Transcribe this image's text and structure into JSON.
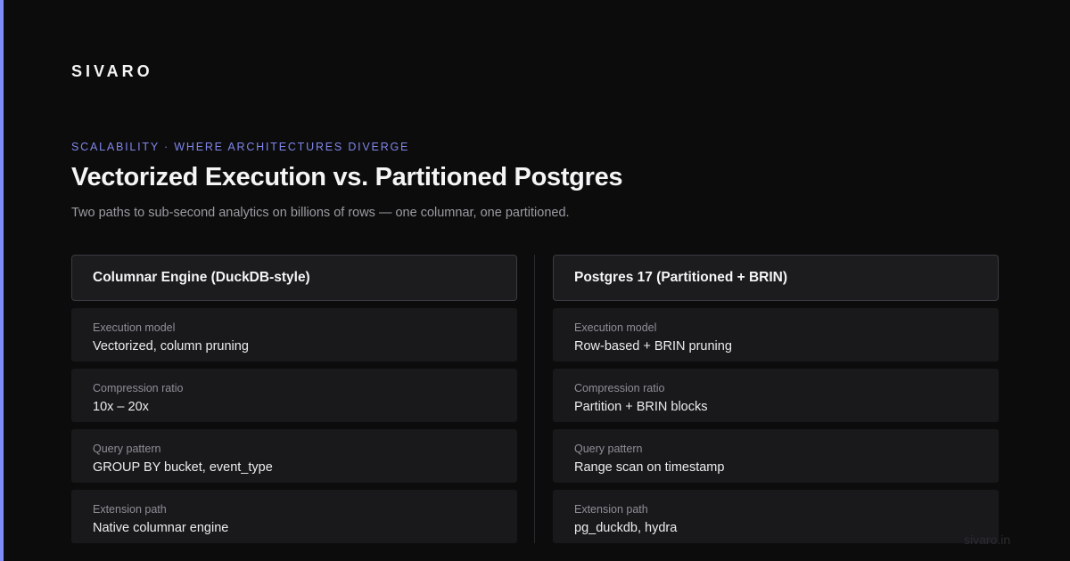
{
  "brand": "SIVARO",
  "eyebrow": "SCALABILITY · WHERE ARCHITECTURES DIVERGE",
  "title": "Vectorized Execution vs. Partitioned Postgres",
  "subtitle": "Two paths to sub-second analytics on billions of rows — one columnar, one partitioned.",
  "columns": [
    {
      "header": "Columnar Engine (DuckDB-style)",
      "rows": [
        {
          "label": "Execution model",
          "value": "Vectorized, column pruning"
        },
        {
          "label": "Compression ratio",
          "value": "10x – 20x"
        },
        {
          "label": "Query pattern",
          "value": "GROUP BY bucket, event_type"
        },
        {
          "label": "Extension path",
          "value": "Native columnar engine"
        }
      ]
    },
    {
      "header": "Postgres 17 (Partitioned + BRIN)",
      "rows": [
        {
          "label": "Execution model",
          "value": "Row-based + BRIN pruning"
        },
        {
          "label": "Compression ratio",
          "value": "Partition + BRIN blocks"
        },
        {
          "label": "Query pattern",
          "value": "Range scan on timestamp"
        },
        {
          "label": "Extension path",
          "value": "pg_duckdb, hydra"
        }
      ]
    }
  ],
  "footer": {
    "domain": "sivaro.in"
  },
  "colors": {
    "background": "#0c0c0d",
    "accent": "#7f8cf7",
    "eyebrow": "#7f86e8",
    "card": "#19191c",
    "header_card": "#1c1c1f"
  }
}
